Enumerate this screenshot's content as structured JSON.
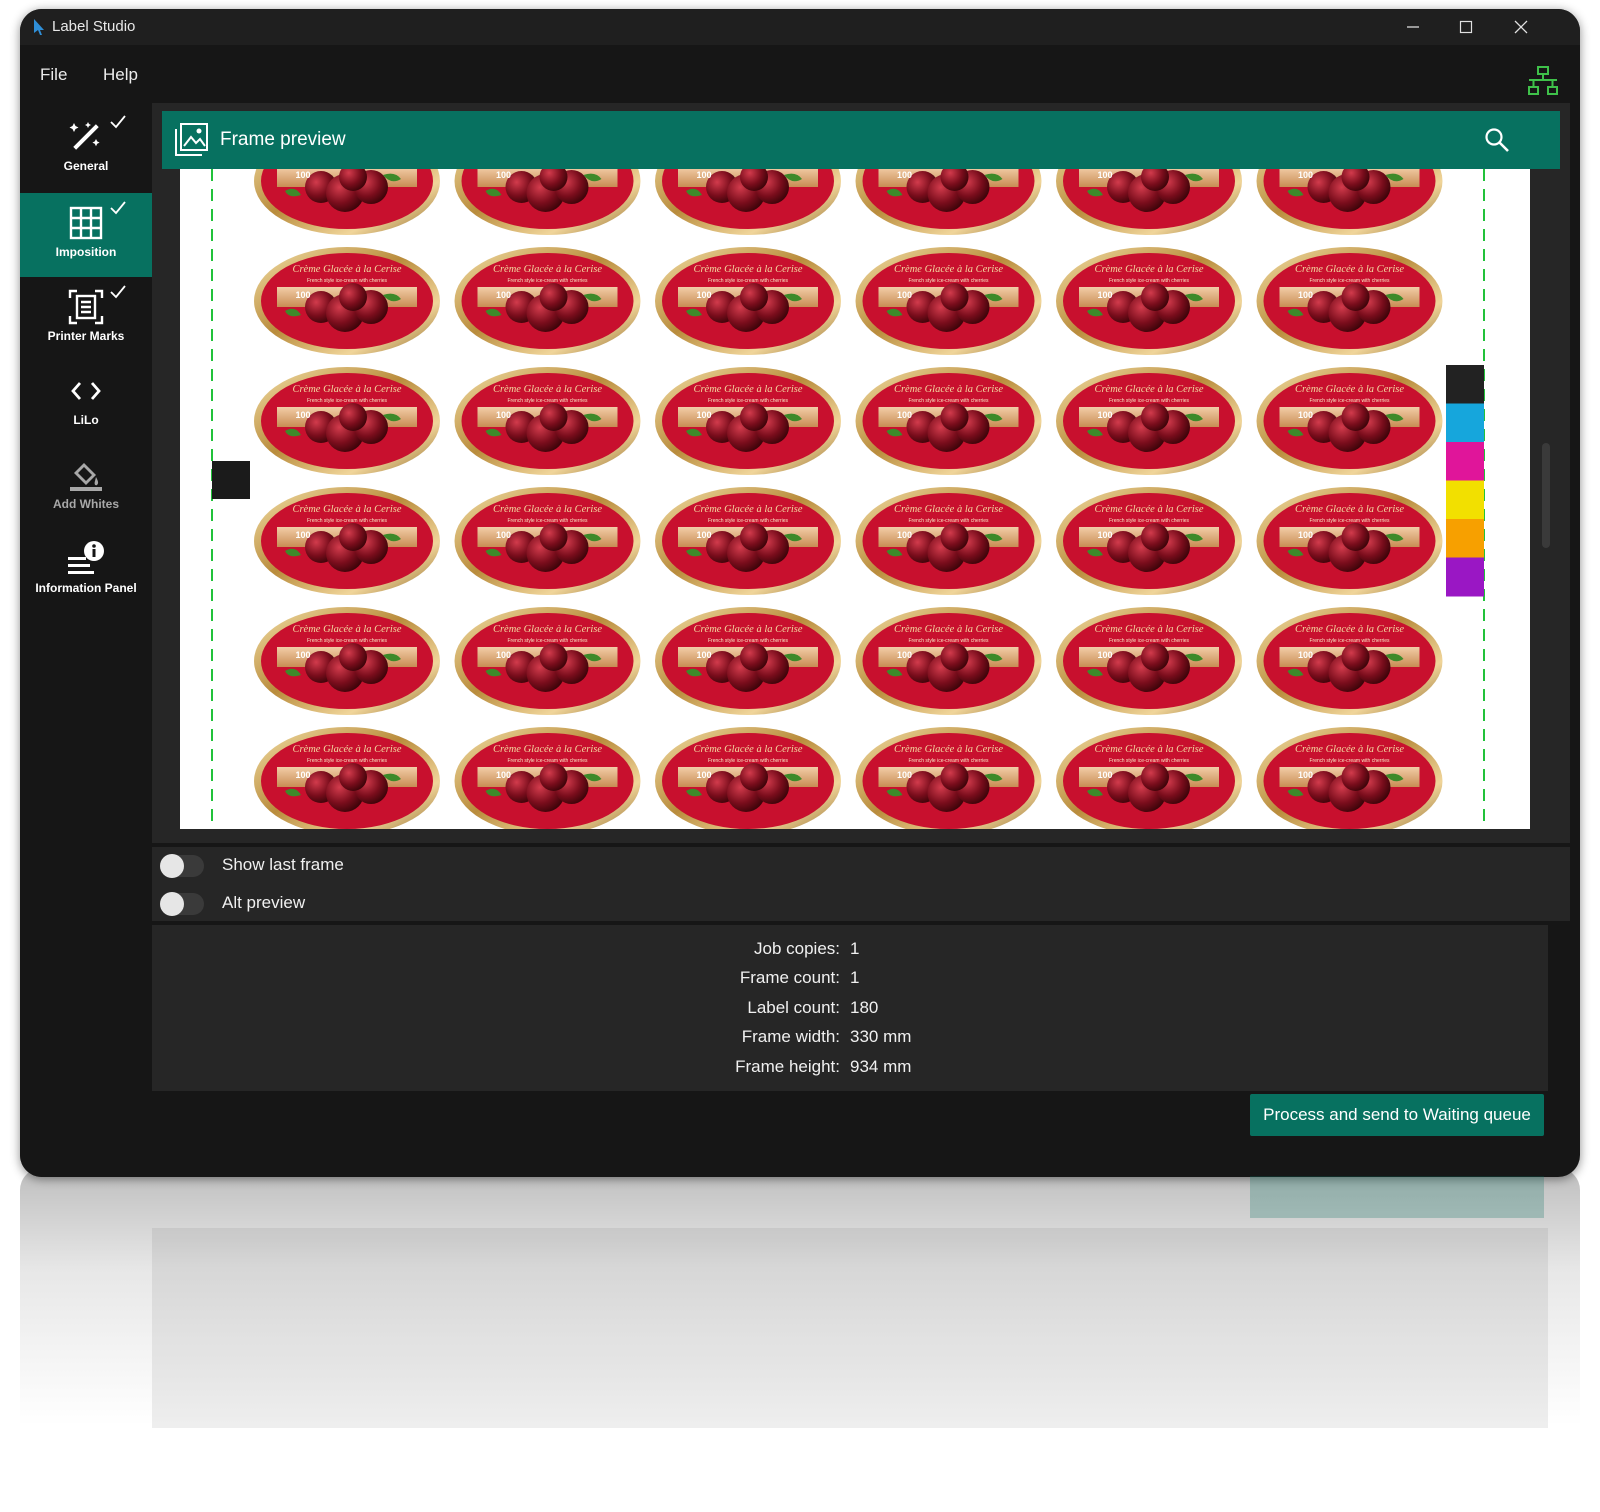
{
  "app": {
    "title": "Label Studio"
  },
  "menu": {
    "file": "File",
    "help": "Help"
  },
  "sidebar": {
    "items": [
      {
        "label": "General",
        "icon": "magic-wand-icon",
        "checked": true,
        "active": false
      },
      {
        "label": "Imposition",
        "icon": "grid-icon",
        "checked": true,
        "active": true
      },
      {
        "label": "Printer Marks",
        "icon": "printer-marks-icon",
        "checked": true,
        "active": false
      },
      {
        "label": "LiLo",
        "icon": "code-brackets-icon",
        "checked": false,
        "active": false
      },
      {
        "label": "Add Whites",
        "icon": "paint-bucket-icon",
        "checked": false,
        "active": false
      },
      {
        "label": "Information Panel",
        "icon": "info-list-icon",
        "checked": false,
        "active": false
      }
    ]
  },
  "preview": {
    "title": "Frame preview",
    "label_texts": {
      "title": "Crème Glacée à la Cerise",
      "subtitle": "French style ice-cream with cherries",
      "badge": "100"
    },
    "label_grid": {
      "columns": 6,
      "rows_visible": 6
    },
    "color_bar": [
      "#222222",
      "#16a6dc",
      "#e0159a",
      "#f2e000",
      "#f7a000",
      "#9a17c4"
    ]
  },
  "options": {
    "show_last_frame": {
      "label": "Show last frame",
      "on": false
    },
    "alt_preview": {
      "label": "Alt preview",
      "on": false
    }
  },
  "info": {
    "rows": [
      {
        "key": "Job copies:",
        "value": "1"
      },
      {
        "key": "Frame count:",
        "value": "1"
      },
      {
        "key": "Label count:",
        "value": "180"
      },
      {
        "key": "Frame width:",
        "value": "330 mm"
      },
      {
        "key": "Frame height:",
        "value": "934 mm"
      }
    ]
  },
  "actions": {
    "process_label": "Process and send to Waiting queue"
  },
  "colors": {
    "accent": "#077160",
    "background": "#161616",
    "panel": "#262626",
    "network": "#3fc14a"
  }
}
